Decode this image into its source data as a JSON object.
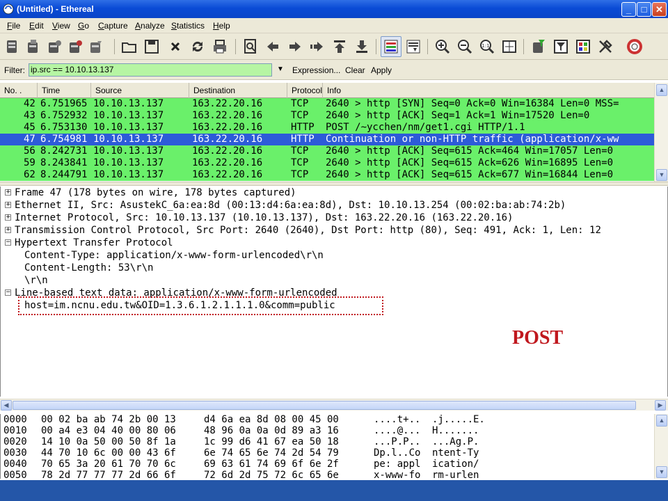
{
  "window": {
    "title": "(Untitled) - Ethereal",
    "minimize_label": "_",
    "maximize_label": "□",
    "close_label": "✕"
  },
  "menu": [
    {
      "label": "File",
      "key": "F",
      "rest": "ile"
    },
    {
      "label": "Edit",
      "key": "E",
      "rest": "dit"
    },
    {
      "label": "View",
      "key": "V",
      "rest": "iew"
    },
    {
      "label": "Go",
      "key": "G",
      "rest": "o"
    },
    {
      "label": "Capture",
      "key": "C",
      "rest": "apture"
    },
    {
      "label": "Analyze",
      "key": "A",
      "rest": "nalyze"
    },
    {
      "label": "Statistics",
      "key": "S",
      "rest": "tatistics"
    },
    {
      "label": "Help",
      "key": "H",
      "rest": "elp"
    }
  ],
  "toolbar": {
    "icons": [
      "interfaces-icon",
      "capture-options-icon",
      "start-capture-icon",
      "stop-capture-icon",
      "restart-capture-icon",
      "open-file-icon",
      "save-file-icon",
      "close-file-icon",
      "reload-icon",
      "print-icon",
      "find-packet-icon",
      "go-back-icon",
      "go-forward-icon",
      "go-to-packet-icon",
      "go-first-icon",
      "go-last-icon",
      "colorize-icon",
      "autoscroll-icon",
      "zoom-in-icon",
      "zoom-out-icon",
      "zoom-normal-icon",
      "resize-columns-icon",
      "capture-filters-icon",
      "display-filters-icon",
      "coloring-rules-icon",
      "preferences-icon",
      "help-icon"
    ]
  },
  "filter": {
    "label": "Filter:",
    "value": "ip.src == 10.10.13.137",
    "expression_label": "Expression...",
    "clear_label": "Clear",
    "apply_label": "Apply",
    "bg_color": "#b6f5a3"
  },
  "packet_list": {
    "columns": [
      "No. .",
      "Time",
      "Source",
      "Destination",
      "Protocol",
      "Info"
    ],
    "rows": [
      {
        "no": "42",
        "time": "6.751965",
        "source": "10.10.13.137",
        "destination": "163.22.20.16",
        "protocol": "TCP",
        "info": "2640 > http [SYN] Seq=0 Ack=0 Win=16384 Len=0 MSS=",
        "selected": false
      },
      {
        "no": "43",
        "time": "6.752932",
        "source": "10.10.13.137",
        "destination": "163.22.20.16",
        "protocol": "TCP",
        "info": "2640 > http [ACK] Seq=1 Ack=1 Win=17520 Len=0",
        "selected": false
      },
      {
        "no": "45",
        "time": "6.753130",
        "source": "10.10.13.137",
        "destination": "163.22.20.16",
        "protocol": "HTTP",
        "info": "POST /~ycchen/nm/get1.cgi HTTP/1.1",
        "selected": false
      },
      {
        "no": "47",
        "time": "6.754981",
        "source": "10.10.13.137",
        "destination": "163.22.20.16",
        "protocol": "HTTP",
        "info": "Continuation or non-HTTP traffic (application/x-ww",
        "selected": true
      },
      {
        "no": "56",
        "time": "8.242731",
        "source": "10.10.13.137",
        "destination": "163.22.20.16",
        "protocol": "TCP",
        "info": "2640 > http [ACK] Seq=615 Ack=464 Win=17057 Len=0",
        "selected": false
      },
      {
        "no": "59",
        "time": "8.243841",
        "source": "10.10.13.137",
        "destination": "163.22.20.16",
        "protocol": "TCP",
        "info": "2640 > http [ACK] Seq=615 Ack=626 Win=16895 Len=0",
        "selected": false
      },
      {
        "no": "62",
        "time": "8.244791",
        "source": "10.10.13.137",
        "destination": "163.22.20.16",
        "protocol": "TCP",
        "info": "2640 > http [ACK] Seq=615 Ack=677 Win=16844 Len=0",
        "selected": false
      }
    ],
    "row_color": "#6af06a",
    "selected_color": "#2d5bd8"
  },
  "details": {
    "lines": [
      {
        "type": "node",
        "expanded": false,
        "text": "Frame 47 (178 bytes on wire, 178 bytes captured)"
      },
      {
        "type": "node",
        "expanded": false,
        "text": "Ethernet II, Src: AsustekC_6a:ea:8d (00:13:d4:6a:ea:8d), Dst: 10.10.13.254 (00:02:ba:ab:74:2b)"
      },
      {
        "type": "node",
        "expanded": false,
        "text": "Internet Protocol, Src: 10.10.13.137 (10.10.13.137), Dst: 163.22.20.16 (163.22.20.16)"
      },
      {
        "type": "node",
        "expanded": false,
        "text": "Transmission Control Protocol, Src Port: 2640 (2640), Dst Port: http (80), Seq: 491, Ack: 1, Len: 12"
      },
      {
        "type": "node",
        "expanded": true,
        "text": "Hypertext Transfer Protocol"
      },
      {
        "type": "leaf",
        "text": "Content-Type: application/x-www-form-urlencoded\\r\\n"
      },
      {
        "type": "leaf",
        "text": "Content-Length: 53\\r\\n"
      },
      {
        "type": "leaf",
        "text": "\\r\\n"
      },
      {
        "type": "node",
        "expanded": true,
        "text": "Line-based text data: application/x-www-form-urlencoded"
      },
      {
        "type": "leaf",
        "text": "host=im.ncnu.edu.tw&OID=1.3.6.1.2.1.1.1.0&comm=public"
      }
    ],
    "annotation": "POST",
    "annotation_color": "#c0181e"
  },
  "hex": {
    "rows": [
      {
        "offset": "0000",
        "hex1": "00 02 ba ab 74 2b 00 13",
        "hex2": "d4 6a ea 8d 08 00 45 00",
        "ascii1": "....t+..",
        "ascii2": ".j.....E."
      },
      {
        "offset": "0010",
        "hex1": "00 a4 e3 04 40 00 80 06",
        "hex2": "48 96 0a 0a 0d 89 a3 16",
        "ascii1": "....@...",
        "ascii2": "H......."
      },
      {
        "offset": "0020",
        "hex1": "14 10 0a 50 00 50 8f 1a",
        "hex2": "1c 99 d6 41 67 ea 50 18",
        "ascii1": "...P.P..",
        "ascii2": "...Ag.P."
      },
      {
        "offset": "0030",
        "hex1": "44 70 10 6c 00 00 43 6f",
        "hex2": "6e 74 65 6e 74 2d 54 79",
        "ascii1": "Dp.l..Co",
        "ascii2": "ntent-Ty"
      },
      {
        "offset": "0040",
        "hex1": "70 65 3a 20 61 70 70 6c",
        "hex2": "69 63 61 74 69 6f 6e 2f",
        "ascii1": "pe: appl",
        "ascii2": "ication/"
      },
      {
        "offset": "0050",
        "hex1": "78 2d 77 77 77 2d 66 6f",
        "hex2": "72 6d 2d 75 72 6c 65 6e",
        "ascii1": "x-www-fo",
        "ascii2": "rm-urlen"
      }
    ]
  }
}
